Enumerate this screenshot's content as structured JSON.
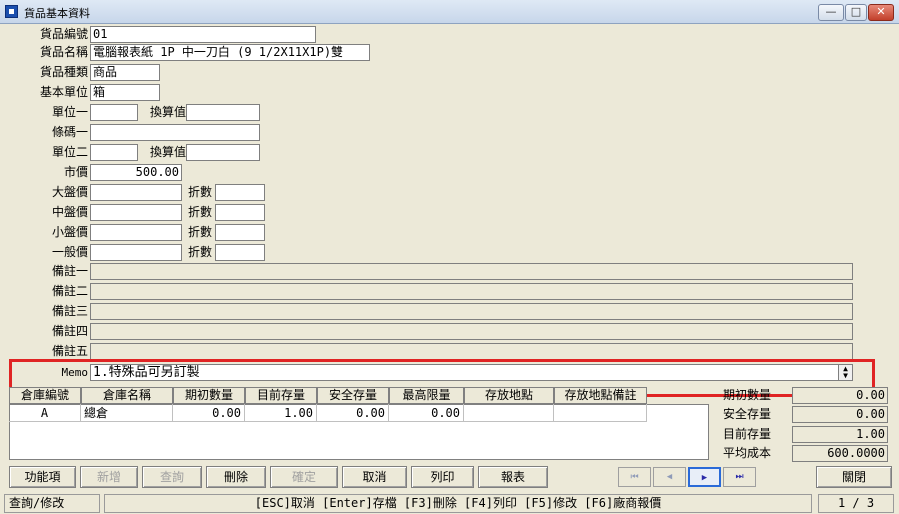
{
  "window": {
    "title": "貨品基本資料",
    "btn_min": "—",
    "btn_max": "□",
    "btn_close": "✕"
  },
  "form": {
    "item_no_label": "貨品編號",
    "item_no": "01",
    "item_name_label": "貨品名稱",
    "item_name": "電腦報表紙 1P 中一刀白 (9 1/2X11X1P)雙",
    "item_type_label": "貨品種類",
    "item_type": "商品",
    "base_unit_label": "基本單位",
    "base_unit": "箱",
    "unit1_label": "單位一",
    "unit1": "",
    "conv1_label": "換算值",
    "conv1": "",
    "barcode1_label": "條碼一",
    "barcode1": "",
    "unit2_label": "單位二",
    "unit2": "",
    "conv2_label": "換算值",
    "conv2": "",
    "market_price_label": "市價",
    "market_price": "500.00",
    "big_price_label": "大盤價",
    "big_price": "",
    "big_disc_label": "折數",
    "big_disc": "",
    "mid_price_label": "中盤價",
    "mid_price": "",
    "mid_disc_label": "折數",
    "mid_disc": "",
    "small_price_label": "小盤價",
    "small_price": "",
    "small_disc_label": "折數",
    "small_disc": "",
    "general_price_label": "一般價",
    "general_price": "",
    "general_disc_label": "折數",
    "general_disc": "",
    "remark1_label": "備註一",
    "remark1": "",
    "remark2_label": "備註二",
    "remark2": "",
    "remark3_label": "備註三",
    "remark3": "",
    "remark4_label": "備註四",
    "remark4": "",
    "remark5_label": "備註五",
    "remark5": "",
    "memo_label": "Memo",
    "memo": "1.特殊品可另訂製"
  },
  "grid": {
    "headers": [
      "倉庫編號",
      "倉庫名稱",
      "期初數量",
      "目前存量",
      "安全存量",
      "最高限量",
      "存放地點",
      "存放地點備註"
    ],
    "rows": [
      {
        "wh_code": "A",
        "wh_name": "總倉",
        "init_qty": "0.00",
        "cur_qty": "1.00",
        "safe_qty": "0.00",
        "max_qty": "0.00",
        "location": "",
        "location_note": ""
      }
    ]
  },
  "summary": {
    "init_qty_label": "期初數量",
    "init_qty": "0.00",
    "safe_qty_label": "安全存量",
    "safe_qty": "0.00",
    "cur_qty_label": "目前存量",
    "cur_qty": "1.00",
    "avg_cost_label": "平均成本",
    "avg_cost": "600.0000"
  },
  "toolbar": {
    "functions": "功能項",
    "add": "新增",
    "query": "查詢",
    "delete": "刪除",
    "confirm": "確定",
    "cancel": "取消",
    "print": "列印",
    "report": "報表",
    "close": "關閉",
    "nav_first": "⏮",
    "nav_prev": "◀",
    "nav_next": "▶",
    "nav_last": "⏭"
  },
  "status": {
    "mode": "查詢/修改",
    "hint": "[ESC]取消 [Enter]存檔 [F3]刪除 [F4]列印 [F5]修改 [F6]廠商報價",
    "page": "1 / 3"
  }
}
